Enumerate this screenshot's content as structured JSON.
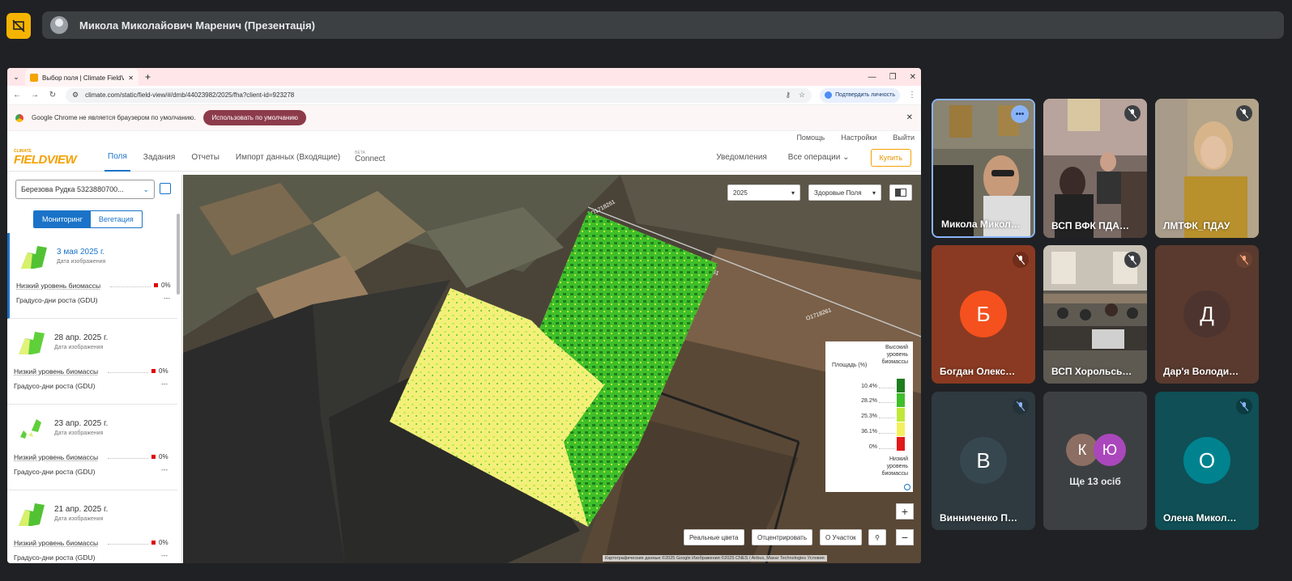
{
  "meet": {
    "presenter_label": "Микола Миколайович Маренич (Презентація)",
    "participants": [
      {
        "name": "Микола Микол…",
        "initial": "",
        "muted": false,
        "video": true
      },
      {
        "name": "ВСП ВФК ПДА…",
        "initial": "",
        "muted": true,
        "video": true
      },
      {
        "name": "ЛМТФК_ПДАУ",
        "initial": "",
        "muted": true,
        "video": true
      },
      {
        "name": "Богдан Олекс…",
        "initial": "Б",
        "muted": true,
        "video": false,
        "avatar_color": "#f4511e"
      },
      {
        "name": "ВСП Хорольсь…",
        "initial": "",
        "muted": true,
        "video": true
      },
      {
        "name": "Дар'я Володи…",
        "initial": "Д",
        "muted": true,
        "video": false,
        "avatar_color": "#5d4037"
      },
      {
        "name": "Винниченко П…",
        "initial": "В",
        "muted": true,
        "video": false,
        "avatar_color": "#37474f"
      },
      {
        "name": "Олена Микол…",
        "initial": "О",
        "muted": true,
        "video": false,
        "avatar_color": "#00838f"
      }
    ],
    "others": {
      "initials": [
        "К",
        "Ю"
      ],
      "label": "Ще 13 осіб"
    }
  },
  "browser": {
    "tab_title": "Выбор поля | Climate FieldView",
    "url": "climate.com/static/field-view/#/dmb/44023982/2025/fha?client-id=923278",
    "profile_chip": "Подтвердить личность",
    "infobar_text": "Google Chrome не является браузером по умолчанию.",
    "infobar_button": "Использовать по умолчанию"
  },
  "fieldview": {
    "logo_small": "CLIMATE",
    "logo_big": "FIELDVIEW",
    "top_links": [
      "Помощь",
      "Настройки",
      "Выйти"
    ],
    "nav": [
      "Поля",
      "Задания",
      "Отчеты",
      "Импорт данных (Входящие)"
    ],
    "nav_beta_tag": "BETA",
    "nav_beta": "Connect",
    "notifications": "Уведомления",
    "all_ops": "Все операции",
    "buy": "Купить",
    "field_select": "Березова Рудка 5323880700...",
    "toggle": [
      "Мониторинг",
      "Вегетация"
    ],
    "images": [
      {
        "date": "3 мая 2025 г.",
        "sub": "Дата изображения",
        "bio_label": "Низкий уровень биомассы",
        "bio_value": "0%",
        "gdu_label": "Градусо-дни роста (GDU)",
        "gdu_value": "---"
      },
      {
        "date": "28 апр. 2025 г.",
        "sub": "Дата изображения",
        "bio_label": "Низкий уровень биомассы",
        "bio_value": "0%",
        "gdu_label": "Градусо-дни роста (GDU)",
        "gdu_value": "---"
      },
      {
        "date": "23 апр. 2025 г.",
        "sub": "Дата изображения",
        "bio_label": "Низкий уровень биомассы",
        "bio_value": "0%",
        "gdu_label": "Градусо-дни роста (GDU)",
        "gdu_value": "---"
      },
      {
        "date": "21 апр. 2025 г.",
        "sub": "Дата изображения",
        "bio_label": "Низкий уровень биомассы",
        "bio_value": "0%",
        "gdu_label": "Градусо-дни роста (GDU)",
        "gdu_value": "---"
      }
    ],
    "map": {
      "year": "2025",
      "layer": "Здоровые Поля",
      "road_labels": [
        "O1718261",
        "O1718261",
        "O1718261"
      ],
      "buttons": [
        "Реальные цвета",
        "Отцентрировать",
        "О Участок"
      ],
      "attribution": "Картографические данные ©2025 Google Изображения ©2025 CNES / Airbus, Maxar Technologies  Условия",
      "legend": {
        "area_label": "Площадь (%)",
        "high_label": "Высокий уровень биомассы",
        "low_label": "Низкий уровень биомассы",
        "rows": [
          {
            "value": "10.4%",
            "color": "#1e7d1e"
          },
          {
            "value": "28.2%",
            "color": "#3fbf2a"
          },
          {
            "value": "25.3%",
            "color": "#bfe83a"
          },
          {
            "value": "36.1%",
            "color": "#f3f060"
          },
          {
            "value": "0%",
            "color": "#e11a1a"
          }
        ]
      }
    }
  }
}
